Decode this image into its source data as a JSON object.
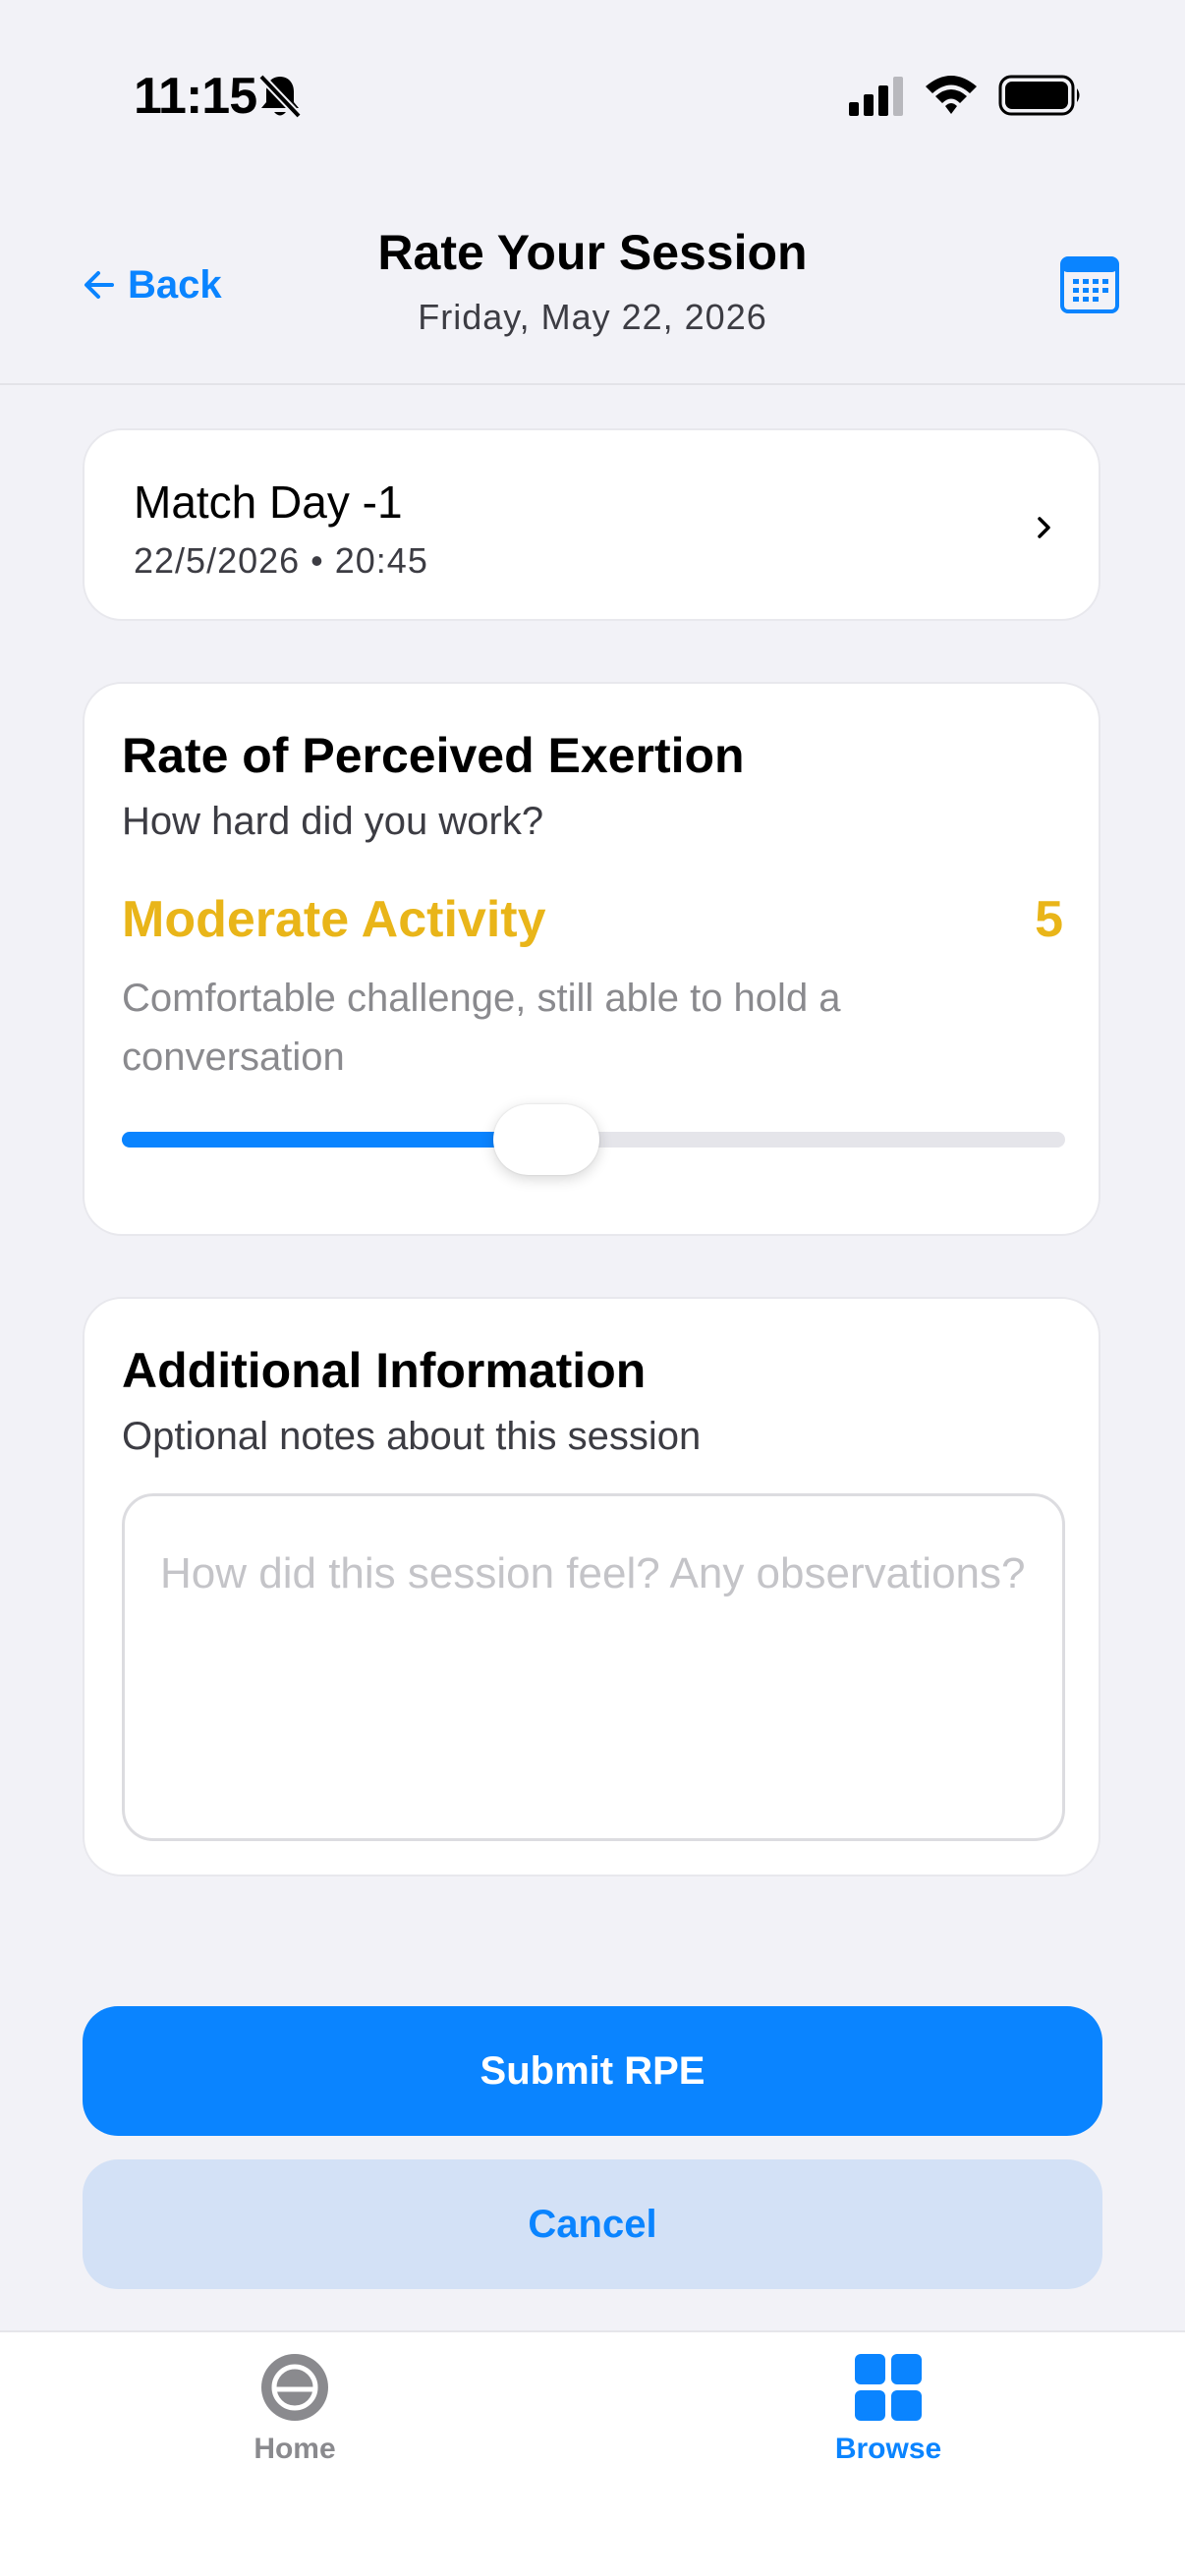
{
  "status_bar": {
    "time": "11:15"
  },
  "header": {
    "back_label": "Back",
    "title": "Rate Your Session",
    "subtitle": "Friday, May 22, 2026"
  },
  "session": {
    "name": "Match Day -1",
    "meta": "22/5/2026 • 20:45"
  },
  "rpe": {
    "heading": "Rate of Perceived Exertion",
    "subheading": "How hard did you work?",
    "intensity_label": "Moderate Activity",
    "value": "5",
    "max": 10,
    "description": "Comfortable challenge, still able to hold a conversation",
    "slider_fraction": 0.45,
    "accent_color": "#e9b519",
    "fill_color": "#0a84ff"
  },
  "notes": {
    "heading": "Additional Information",
    "subheading": "Optional notes about this session",
    "placeholder": "How did this session feel? Any observations?",
    "value": ""
  },
  "actions": {
    "submit_label": "Submit RPE",
    "cancel_label": "Cancel"
  },
  "tab_bar": {
    "items": [
      {
        "label": "Home",
        "icon": "home-icon",
        "active": false
      },
      {
        "label": "Browse",
        "icon": "grid-icon",
        "active": true
      }
    ]
  },
  "colors": {
    "accent": "#0a84ff",
    "background": "#f2f2f7",
    "card": "#ffffff"
  }
}
